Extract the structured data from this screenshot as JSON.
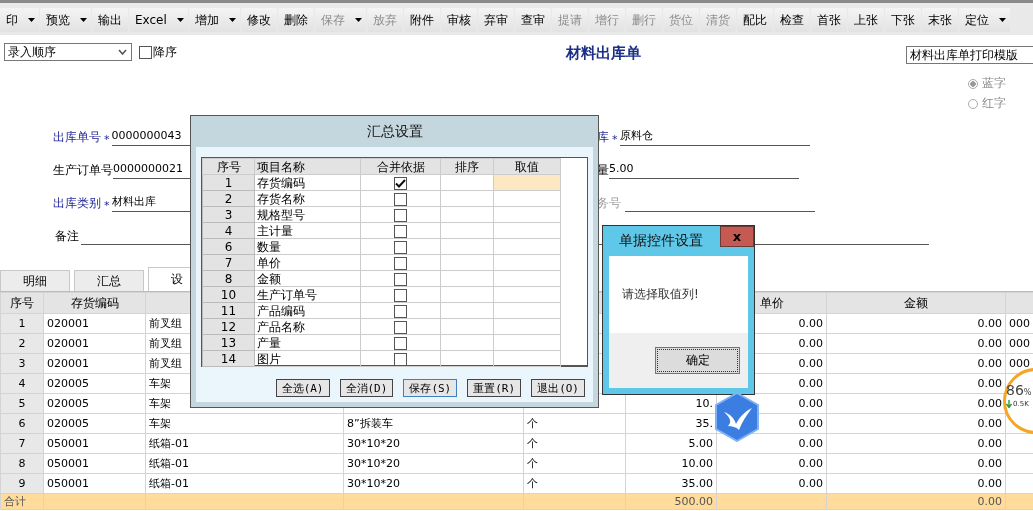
{
  "toolbar": [
    {
      "label": "印",
      "disabled": false,
      "dropdown": true
    },
    {
      "label": "预览",
      "disabled": false,
      "dropdown": true
    },
    {
      "label": "输出",
      "disabled": false,
      "dropdown": false
    },
    {
      "label": "Excel",
      "disabled": false,
      "dropdown": true
    },
    {
      "label": "增加",
      "disabled": false,
      "dropdown": true
    },
    {
      "label": "修改",
      "disabled": false,
      "dropdown": false
    },
    {
      "label": "删除",
      "disabled": false,
      "dropdown": false
    },
    {
      "label": "保存",
      "disabled": true,
      "dropdown": true
    },
    {
      "label": "放弃",
      "disabled": true,
      "dropdown": false
    },
    {
      "label": "附件",
      "disabled": false,
      "dropdown": false
    },
    {
      "label": "审核",
      "disabled": false,
      "dropdown": false
    },
    {
      "label": "弃审",
      "disabled": false,
      "dropdown": false
    },
    {
      "label": "查审",
      "disabled": false,
      "dropdown": false
    },
    {
      "label": "提请",
      "disabled": true,
      "dropdown": false
    },
    {
      "label": "增行",
      "disabled": true,
      "dropdown": false
    },
    {
      "label": "删行",
      "disabled": true,
      "dropdown": false
    },
    {
      "label": "货位",
      "disabled": true,
      "dropdown": false
    },
    {
      "label": "清货",
      "disabled": true,
      "dropdown": false
    },
    {
      "label": "配比",
      "disabled": false,
      "dropdown": false
    },
    {
      "label": "检查",
      "disabled": false,
      "dropdown": false
    },
    {
      "label": "首张",
      "disabled": false,
      "dropdown": false
    },
    {
      "label": "上张",
      "disabled": false,
      "dropdown": false
    },
    {
      "label": "下张",
      "disabled": false,
      "dropdown": false
    },
    {
      "label": "末张",
      "disabled": false,
      "dropdown": false
    },
    {
      "label": "定位",
      "disabled": false,
      "dropdown": true
    }
  ],
  "sort_select": {
    "value": "录入顺序"
  },
  "descending": {
    "label": "降序",
    "checked": false
  },
  "title": "材料出库单",
  "template_select": {
    "value": "材料出库单打印模版"
  },
  "color_radios": [
    {
      "label": "蓝字",
      "selected": true,
      "disabled": true
    },
    {
      "label": "红字",
      "selected": false,
      "disabled": true
    }
  ],
  "form": {
    "left": [
      {
        "label": "出库单号",
        "required": true,
        "mark": "*",
        "value": "0000000043"
      },
      {
        "label": "生产订单号",
        "required": false,
        "value": "0000000021"
      },
      {
        "label": "出库类别",
        "required": true,
        "mark": "*",
        "value": "材料出库"
      }
    ],
    "right": [
      {
        "label": "库",
        "required": true,
        "mark": "*",
        "value": "原料仓"
      },
      {
        "label": "量",
        "required": false,
        "value": "5.00"
      },
      {
        "label": "务号",
        "required": false,
        "disabled": true
      }
    ],
    "remark": {
      "label": "备注"
    }
  },
  "tabs": [
    {
      "label": "明细",
      "selected": false
    },
    {
      "label": "汇总",
      "selected": false
    },
    {
      "label": "设",
      "selected": true
    }
  ],
  "table": {
    "columns": {
      "no": "序号",
      "code": "存货编码",
      "price": "单价",
      "amount": "金额"
    },
    "rows": [
      {
        "no": "1",
        "code": "020001",
        "column_3": "前叉组",
        "price": "0.00",
        "amount": "0.00",
        "column_9": "000"
      },
      {
        "no": "2",
        "code": "020001",
        "column_3": "前叉组",
        "price": "0.00",
        "amount": "0.00",
        "column_9": "000"
      },
      {
        "no": "3",
        "code": "020001",
        "column_3": "前叉组",
        "price": "0.00",
        "amount": "0.00",
        "column_9": "000"
      },
      {
        "no": "4",
        "code": "020005",
        "column_3": "车架",
        "price": "0.00",
        "amount": "0.00"
      },
      {
        "no": "5",
        "code": "020005",
        "column_3": "车架",
        "column_6": "10.",
        "price": "0.00",
        "amount": "0.00"
      },
      {
        "no": "6",
        "code": "020005",
        "column_3": "车架",
        "column_4": "8”拆装车",
        "column_5": "个",
        "column_6": "35.",
        "price": "0.00",
        "amount": "0.00"
      },
      {
        "no": "7",
        "code": "050001",
        "column_3": "纸箱-01",
        "column_4": "30*10*20",
        "column_5": "个",
        "column_6": "5.00",
        "price": "0.00",
        "amount": "0.00"
      },
      {
        "no": "8",
        "code": "050001",
        "column_3": "纸箱-01",
        "column_4": "30*10*20",
        "column_5": "个",
        "column_6": "10.00",
        "price": "0.00",
        "amount": "0.00"
      },
      {
        "no": "9",
        "code": "050001",
        "column_3": "纸箱-01",
        "column_4": "30*10*20",
        "column_5": "个",
        "column_6": "35.00",
        "price": "0.00",
        "amount": "0.00"
      }
    ],
    "total": {
      "no": "合计",
      "column_6": "500.00",
      "amount": "0.00"
    }
  },
  "summary_dialog": {
    "title": "汇总设置",
    "columns": [
      "序号",
      "项目名称",
      "合并依据",
      "排序",
      "取值"
    ],
    "rows": [
      {
        "index": "1",
        "name": "存货编码",
        "checked": true,
        "value_selected": true
      },
      {
        "index": "2",
        "name": "存货名称",
        "checked": false,
        "value_selected": false
      },
      {
        "index": "3",
        "name": "规格型号",
        "checked": false,
        "value_selected": false
      },
      {
        "index": "4",
        "name": "主计量",
        "checked": false,
        "value_selected": false
      },
      {
        "index": "6",
        "name": "数量",
        "checked": false,
        "value_selected": false
      },
      {
        "index": "7",
        "name": "单价",
        "checked": false,
        "value_selected": false
      },
      {
        "index": "8",
        "name": "金额",
        "checked": false,
        "value_selected": false
      },
      {
        "index": "10",
        "name": "生产订单号",
        "checked": false,
        "value_selected": false
      },
      {
        "index": "11",
        "name": "产品编码",
        "checked": false,
        "value_selected": false
      },
      {
        "index": "12",
        "name": "产品名称",
        "checked": false,
        "value_selected": false
      },
      {
        "index": "13",
        "name": "产量",
        "checked": false,
        "value_selected": false
      },
      {
        "index": "14",
        "name": "图片",
        "checked": false,
        "value_selected": false
      }
    ],
    "buttons": [
      {
        "label": "全选(A)",
        "focused": false
      },
      {
        "label": "全消(D)",
        "focused": false
      },
      {
        "label": "保存(S)",
        "focused": true
      },
      {
        "label": "重置(R)",
        "focused": false
      },
      {
        "label": "退出(O)",
        "focused": false
      }
    ]
  },
  "message_dialog": {
    "title": "单据控件设置",
    "close": "x",
    "message": "请选择取值列!",
    "button": "确定"
  },
  "speed_widget": {
    "percent": "86",
    "unit": "%",
    "rate": "0.5K"
  }
}
